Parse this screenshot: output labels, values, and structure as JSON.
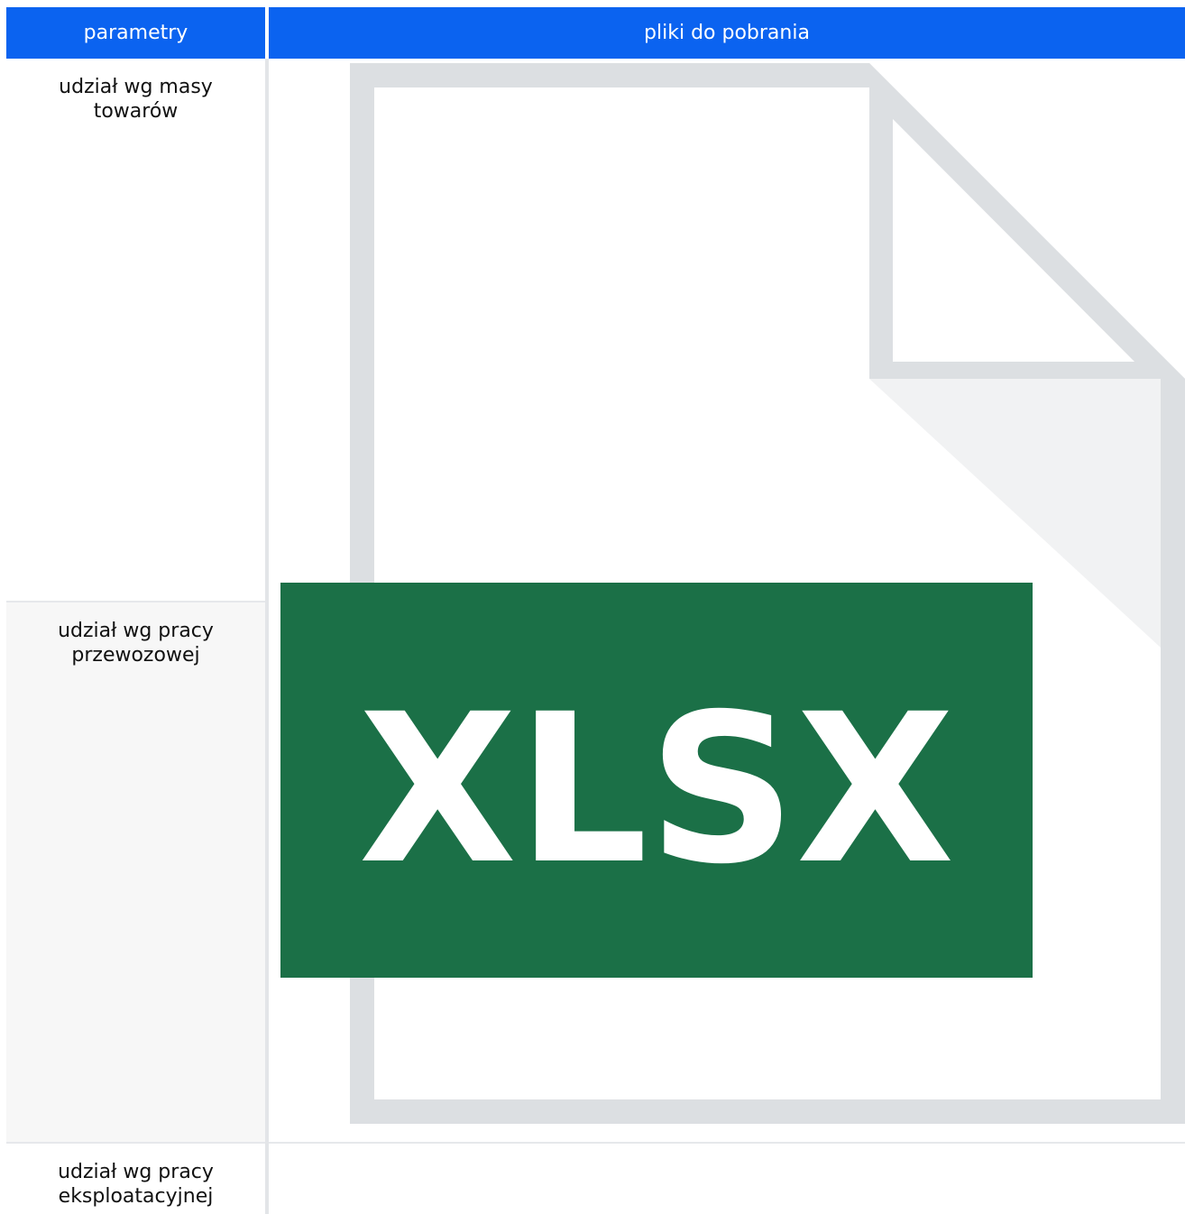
{
  "table": {
    "headers": {
      "params": "parametry",
      "files": "pliki do pobrania"
    },
    "rows": [
      {
        "param": "udział wg masy towarów",
        "file": "xlsx-file-icon"
      },
      {
        "param": "udział wg pracy przewozowej",
        "file": ""
      },
      {
        "param": "udział wg pracy eksploatacyjnej",
        "file": ""
      }
    ]
  },
  "icon": {
    "label": "XLSX",
    "band_color": "#1b7047",
    "page_outline_color": "#dcdfe2"
  }
}
